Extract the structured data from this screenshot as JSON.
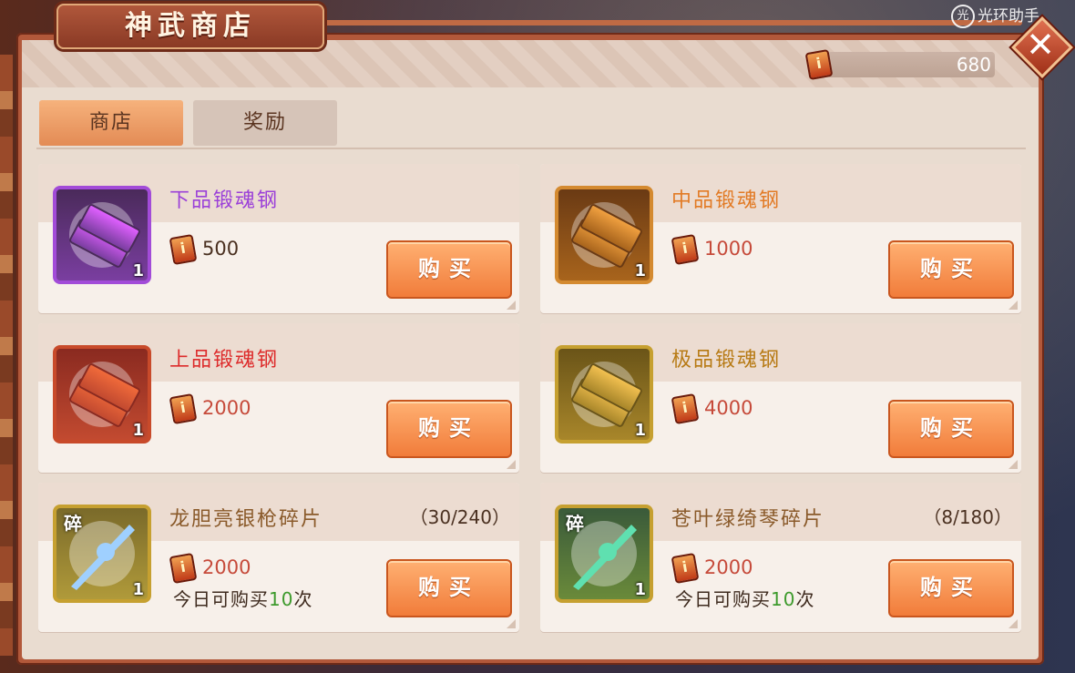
{
  "window": {
    "title": "神武商店",
    "close_label": "✕"
  },
  "watermark": {
    "icon": "光",
    "text": "光环助手"
  },
  "currency": {
    "icon": "i",
    "amount": "680"
  },
  "tabs": [
    {
      "label": "商店",
      "active": true
    },
    {
      "label": "奖励",
      "active": false
    }
  ],
  "shop": {
    "items": [
      {
        "name": "下品锻魂钢",
        "name_color": "#9b40d8",
        "price": "500",
        "price_color": "#4a3020",
        "quantity": "1",
        "frame_color": "#a24bd8",
        "fill_top": "#4a2a5a",
        "fill_bottom": "#7a3ea0",
        "ingot_color": "#e060ff",
        "buy_label": "购买"
      },
      {
        "name": "中品锻魂钢",
        "name_color": "#e27a24",
        "price": "1000",
        "price_color": "#c64a3a",
        "quantity": "1",
        "frame_color": "#d48a30",
        "fill_top": "#6a3a14",
        "fill_bottom": "#a8641c",
        "ingot_color": "#f0a040",
        "buy_label": "购买"
      },
      {
        "name": "上品锻魂钢",
        "name_color": "#dd2b2b",
        "price": "2000",
        "price_color": "#c64a3a",
        "quantity": "1",
        "frame_color": "#c84a2a",
        "fill_top": "#8a2a20",
        "fill_bottom": "#c24a30",
        "ingot_color": "#f06a3a",
        "buy_label": "购买"
      },
      {
        "name": "极品锻魂钢",
        "name_color": "#b77a14",
        "price": "4000",
        "price_color": "#c64a3a",
        "quantity": "1",
        "frame_color": "#c6a030",
        "fill_top": "#6a5418",
        "fill_bottom": "#a8862a",
        "ingot_color": "#f2c050",
        "buy_label": "购买"
      },
      {
        "name": "龙胆亮银枪碎片",
        "name_color": "#8a5a2a",
        "progress": "（30/240）",
        "price": "2000",
        "price_color": "#c64a3a",
        "quantity": "1",
        "badge": "碎",
        "limit_prefix": "今日可购买",
        "limit_count": "10",
        "limit_suffix": "次",
        "frame_color": "#c6a030",
        "fill_top": "#7a6a2a",
        "fill_bottom": "#b09a3a",
        "weapon_color": "#9fd0ff",
        "buy_label": "购买"
      },
      {
        "name": "苍叶绿绮琴碎片",
        "name_color": "#8a5a2a",
        "progress": "（8/180）",
        "price": "2000",
        "price_color": "#c64a3a",
        "quantity": "1",
        "badge": "碎",
        "limit_prefix": "今日可购买",
        "limit_count": "10",
        "limit_suffix": "次",
        "frame_color": "#c6a030",
        "fill_top": "#3a5a3a",
        "fill_bottom": "#6a8a3a",
        "weapon_color": "#5fe0b0",
        "buy_label": "购买"
      }
    ]
  }
}
